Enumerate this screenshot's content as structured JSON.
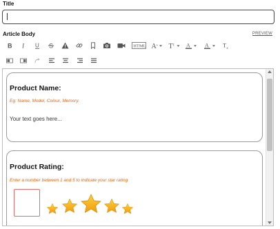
{
  "title_field": {
    "label": "Title",
    "value": "",
    "cursor_char": "|"
  },
  "body_field": {
    "label": "Article Body",
    "preview_label": "PREVIEW"
  },
  "toolbar": {
    "row1": [
      {
        "name": "bold-icon",
        "glyph": "B"
      },
      {
        "name": "italic-icon",
        "glyph": "I"
      },
      {
        "name": "underline-icon",
        "glyph": "U"
      },
      {
        "name": "strikethrough-icon",
        "glyph": "S"
      },
      {
        "name": "warning-icon",
        "glyph": "!"
      },
      {
        "name": "link-icon",
        "glyph": ""
      },
      {
        "name": "bookmark-icon",
        "glyph": ""
      },
      {
        "name": "camera-icon",
        "glyph": ""
      },
      {
        "name": "video-icon",
        "glyph": ""
      },
      {
        "name": "html-icon",
        "glyph": "HTML"
      },
      {
        "name": "font-size-icon",
        "glyph": "A"
      },
      {
        "name": "text-type-icon",
        "glyph": "T"
      },
      {
        "name": "font-color-icon",
        "glyph": "A"
      },
      {
        "name": "highlight-color-icon",
        "glyph": "A"
      },
      {
        "name": "clear-format-icon",
        "glyph": "T"
      }
    ],
    "row2": [
      {
        "name": "indent-icon"
      },
      {
        "name": "outdent-icon"
      },
      {
        "name": "redo-icon"
      },
      {
        "name": "align-left-icon"
      },
      {
        "name": "align-center-icon"
      },
      {
        "name": "align-right-icon"
      },
      {
        "name": "align-justify-icon"
      }
    ]
  },
  "editor": {
    "product_name": {
      "heading": "Product Name:",
      "hint": "Eg: Name, Model, Colour, Memory.",
      "body": "Your text goes here..."
    },
    "product_rating": {
      "heading": "Product Rating:",
      "hint": "Enter a number between 1 and 5 to indicate your star rating",
      "value": ""
    }
  },
  "colors": {
    "hint_orange": "#e8620a",
    "star_gold": "#f4b41a",
    "rating_box_border": "#e26a6a"
  }
}
